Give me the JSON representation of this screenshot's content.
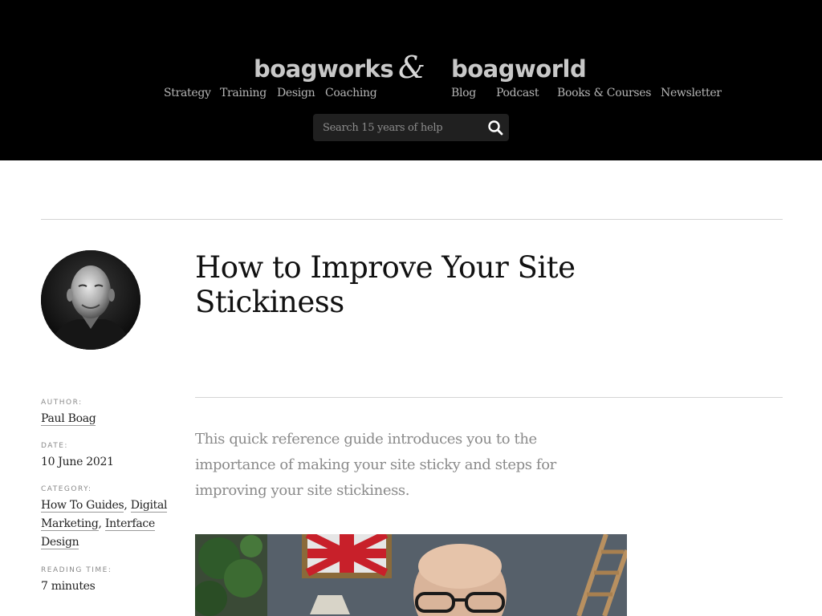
{
  "header": {
    "brand_left": "boagworks",
    "ampersand": "&",
    "brand_right": "boagworld",
    "nav": {
      "strategy": "Strategy",
      "training": "Training",
      "design": "Design",
      "coaching": "Coaching",
      "blog": "Blog",
      "podcast": "Podcast",
      "books": "Books & Courses",
      "newsletter": "Newsletter"
    },
    "search": {
      "placeholder": "Search 15 years of help"
    }
  },
  "article": {
    "title": "How to Improve Your Site Stickiness",
    "intro": "This quick reference guide introduces you to the importance of making your site sticky and steps for improving your site stickiness."
  },
  "meta": {
    "author_label": "Author:",
    "author": "Paul Boag",
    "date_label": "Date:",
    "date": "10 June 2021",
    "category_label": "Category:",
    "categories": [
      "How To Guides",
      "Digital Marketing",
      "Interface Design"
    ],
    "reading_label": "Reading time:",
    "reading_time": "7 minutes"
  },
  "colors": {
    "header_bg": "#000000",
    "nav_text": "#b5b5b5",
    "intro_text": "#8a8a8a"
  }
}
